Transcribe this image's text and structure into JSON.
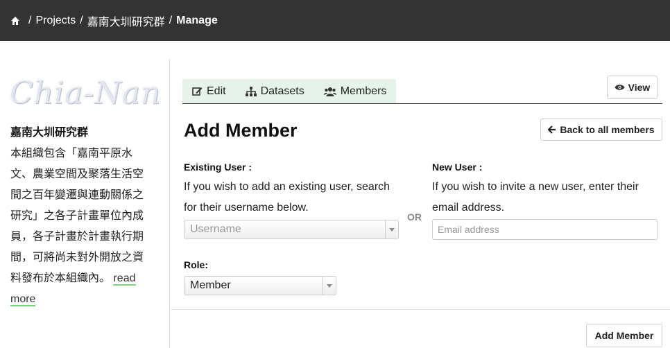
{
  "breadcrumb": {
    "items": [
      "Projects",
      "嘉南大圳研究群"
    ],
    "current": "Manage"
  },
  "icons": {
    "home": "home-icon",
    "edit": "edit-icon",
    "datasets": "sitemap-icon",
    "members": "users-icon",
    "view": "eye-icon",
    "back": "arrow-left-icon"
  },
  "sidebar": {
    "logo_text": "Chia-Nan",
    "org_name": "嘉南大圳研究群",
    "description": "本組織包含「嘉南平原水文、農業空間及聚落生活空間之百年變遷與連動關係之研究」之各子計畫單位內成員，各子計畫於計畫執行期間，可將尚未對外開放之資料發布於本組織內。",
    "read_more": "read more"
  },
  "tabs": [
    {
      "label": "Edit"
    },
    {
      "label": "Datasets"
    },
    {
      "label": "Members"
    }
  ],
  "buttons": {
    "view": "View",
    "back": "Back to all members",
    "add_member": "Add Member"
  },
  "form": {
    "title": "Add Member",
    "existing_label": "Existing User :",
    "existing_help": "If you wish to add an existing user, search for their username below.",
    "username_placeholder": "Username",
    "or": "OR",
    "new_label": "New User :",
    "new_help": "If you wish to invite a new user, enter their email address.",
    "email_placeholder": "Email address",
    "role_label": "Role:",
    "role_value": "Member"
  },
  "colors": {
    "topbar": "#333333",
    "tab_bg": "#e6f2ea",
    "read_more_underline": "#7ed37e"
  }
}
